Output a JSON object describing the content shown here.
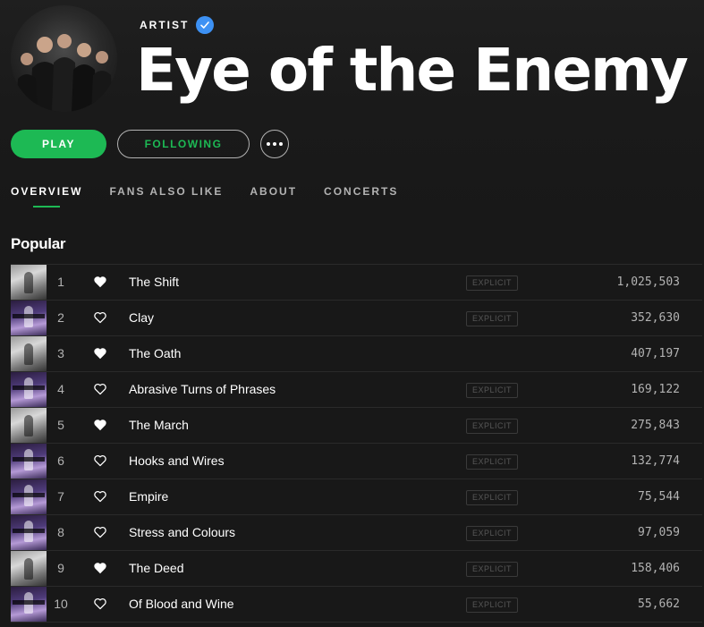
{
  "header": {
    "label": "ARTIST",
    "name": "Eye of the Enemy"
  },
  "actions": {
    "play": "PLAY",
    "following": "FOLLOWING"
  },
  "tabs": [
    {
      "label": "OVERVIEW",
      "active": true
    },
    {
      "label": "FANS ALSO LIKE",
      "active": false
    },
    {
      "label": "ABOUT",
      "active": false
    },
    {
      "label": "CONCERTS",
      "active": false
    }
  ],
  "popular": {
    "title": "Popular",
    "tracks": [
      {
        "num": "1",
        "title": "The Shift",
        "explicit": true,
        "plays": "1,025,503",
        "liked": true,
        "cover": "grey"
      },
      {
        "num": "2",
        "title": "Clay",
        "explicit": true,
        "plays": "352,630",
        "liked": false,
        "cover": "purple"
      },
      {
        "num": "3",
        "title": "The Oath",
        "explicit": false,
        "plays": "407,197",
        "liked": true,
        "cover": "grey"
      },
      {
        "num": "4",
        "title": "Abrasive Turns of Phrases",
        "explicit": true,
        "plays": "169,122",
        "liked": false,
        "cover": "purple"
      },
      {
        "num": "5",
        "title": "The March",
        "explicit": true,
        "plays": "275,843",
        "liked": true,
        "cover": "grey"
      },
      {
        "num": "6",
        "title": "Hooks and Wires",
        "explicit": true,
        "plays": "132,774",
        "liked": false,
        "cover": "purple"
      },
      {
        "num": "7",
        "title": "Empire",
        "explicit": true,
        "plays": "75,544",
        "liked": false,
        "cover": "purple"
      },
      {
        "num": "8",
        "title": "Stress and Colours",
        "explicit": true,
        "plays": "97,059",
        "liked": false,
        "cover": "purple"
      },
      {
        "num": "9",
        "title": "The Deed",
        "explicit": true,
        "plays": "158,406",
        "liked": true,
        "cover": "grey"
      },
      {
        "num": "10",
        "title": "Of Blood and Wine",
        "explicit": true,
        "plays": "55,662",
        "liked": false,
        "cover": "purple"
      }
    ],
    "explicit_label": "EXPLICIT"
  },
  "colors": {
    "accent": "#1db954",
    "verified": "#3d91f4",
    "background": "#181818"
  },
  "icons": {
    "verified": "verified-check-icon",
    "more": "more-dots-icon",
    "liked": "heart-filled-icon",
    "not_liked": "heart-outline-icon"
  }
}
